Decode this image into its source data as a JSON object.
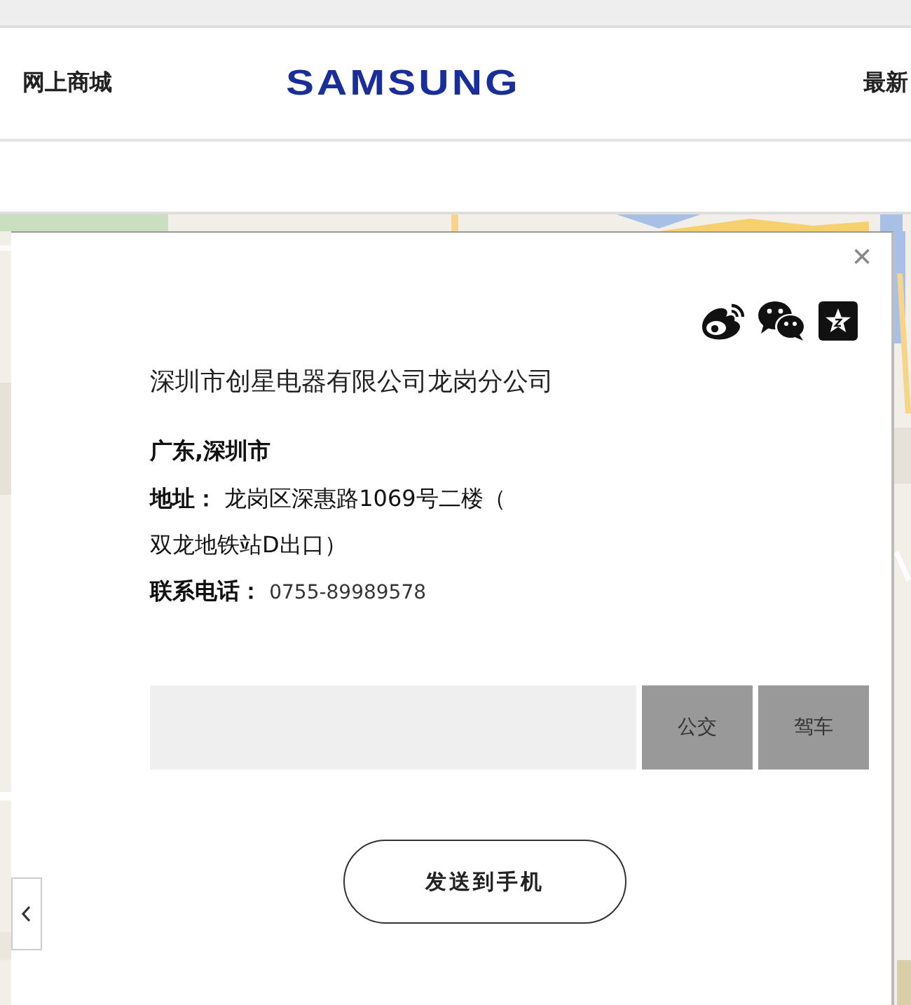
{
  "header": {
    "left_link": "网上商城",
    "logo": "SAMSUNG",
    "right_link": "最新"
  },
  "popup": {
    "close": "×",
    "title": "深圳市创星电器有限公司龙岗分公司",
    "region": "广东,深圳市",
    "address": {
      "label": "地址：",
      "lines": [
        "龙岗区深惠路1069号二楼（",
        "双龙地铁站D出口）"
      ]
    },
    "phone": {
      "label": "联系电话：",
      "value": "0755-89989578"
    },
    "route_buttons": [
      "公交",
      "驾车"
    ],
    "send_button": "发送到手机"
  }
}
